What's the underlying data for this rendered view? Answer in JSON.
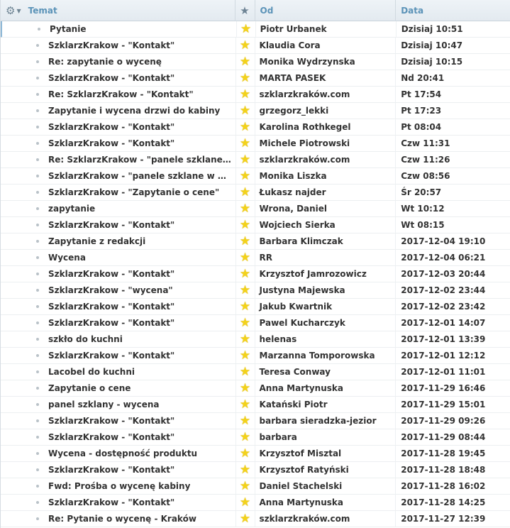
{
  "header": {
    "options_icon": "gear-icon",
    "subject_label": "Temat",
    "star_icon": "star-icon",
    "from_label": "Od",
    "date_label": "Data"
  },
  "colors": {
    "header_text": "#5b93b8",
    "star": "#f3d21b",
    "selected_indicator": "#8fb8d6"
  },
  "messages": [
    {
      "subject": "Pytanie",
      "from": "Piotr Urbanek",
      "date": "Dzisiaj 10:51"
    },
    {
      "subject": "SzklarzKrakow - \"Kontakt\"",
      "from": "Klaudia Cora",
      "date": "Dzisiaj 10:47"
    },
    {
      "subject": "Re: zapytanie o wycenę",
      "from": "Monika Wydrzynska",
      "date": "Dzisiaj 10:15"
    },
    {
      "subject": "SzklarzKrakow - \"Kontakt\"",
      "from": "MARTA PASEK",
      "date": "Nd 20:41"
    },
    {
      "subject": "Re: SzklarzKrakow - \"Kontakt\"",
      "from": "szklarzkraków.com",
      "date": "Pt 17:54"
    },
    {
      "subject": "Zapytanie i wycena drzwi do kabiny",
      "from": "grzegorz_lekki",
      "date": "Pt 17:23"
    },
    {
      "subject": "SzklarzKrakow - \"Kontakt\"",
      "from": "Karolina Rothkegel",
      "date": "Pt 08:04"
    },
    {
      "subject": "SzklarzKrakow - \"Kontakt\"",
      "from": "Michele Piotrowski",
      "date": "Czw 11:31"
    },
    {
      "subject": "Re: SzklarzKrakow - \"panele szklane ...",
      "from": "szklarzkraków.com",
      "date": "Czw 11:26"
    },
    {
      "subject": "SzklarzKrakow - \"panele szklane w k...",
      "from": "Monika Liszka",
      "date": "Czw 08:56"
    },
    {
      "subject": "SzklarzKrakow - \"Zapytanie o cene\"",
      "from": "Łukasz najder",
      "date": "Śr 20:57"
    },
    {
      "subject": "zapytanie",
      "from": "Wrona, Daniel",
      "date": "Wt 10:12"
    },
    {
      "subject": "SzklarzKrakow - \"Kontakt\"",
      "from": "Wojciech Sierka",
      "date": "Wt 08:15"
    },
    {
      "subject": "Zapytanie z redakcji",
      "from": "Barbara Klimczak",
      "date": "2017-12-04 19:10"
    },
    {
      "subject": "Wycena",
      "from": "RR",
      "date": "2017-12-04 06:21"
    },
    {
      "subject": "SzklarzKrakow - \"Kontakt\"",
      "from": "Krzysztof Jamrozowicz",
      "date": "2017-12-03 20:44"
    },
    {
      "subject": "SzklarzKrakow - \"wycena\"",
      "from": "Justyna Majewska",
      "date": "2017-12-02 23:44"
    },
    {
      "subject": "SzklarzKrakow - \"Kontakt\"",
      "from": "Jakub Kwartnik",
      "date": "2017-12-02 23:42"
    },
    {
      "subject": "SzklarzKrakow - \"Kontakt\"",
      "from": "Pawel Kucharczyk",
      "date": "2017-12-01 14:07"
    },
    {
      "subject": "szkło do kuchni",
      "from": "helenas",
      "date": "2017-12-01 13:39"
    },
    {
      "subject": "SzklarzKrakow - \"Kontakt\"",
      "from": "Marzanna Tomporowska",
      "date": "2017-12-01 12:12"
    },
    {
      "subject": "Lacobel do kuchni",
      "from": "Teresa Conway",
      "date": "2017-12-01 11:01"
    },
    {
      "subject": "Zapytanie o cene",
      "from": "Anna Martynuska",
      "date": "2017-11-29 16:46"
    },
    {
      "subject": "panel szklany - wycena",
      "from": "Katański Piotr",
      "date": "2017-11-29 15:01"
    },
    {
      "subject": "SzklarzKrakow - \"Kontakt\"",
      "from": "barbara sieradzka-jezior",
      "date": "2017-11-29 09:26"
    },
    {
      "subject": "SzklarzKrakow - \"Kontakt\"",
      "from": "barbara",
      "date": "2017-11-29 08:44"
    },
    {
      "subject": "Wycena - dostępność produktu",
      "from": "Krzysztof Misztal",
      "date": "2017-11-28 19:45"
    },
    {
      "subject": "SzklarzKrakow - \"Kontakt\"",
      "from": "Krzysztof Ratyński",
      "date": "2017-11-28 18:48"
    },
    {
      "subject": "Fwd: Prośba o wycenę kabiny",
      "from": "Daniel Stachelski",
      "date": "2017-11-28 16:02"
    },
    {
      "subject": "SzklarzKrakow - \"Kontakt\"",
      "from": "Anna Martynuska",
      "date": "2017-11-28 14:25"
    },
    {
      "subject": "Re: Pytanie o wycenę - Kraków",
      "from": "szklarzkraków.com",
      "date": "2017-11-27 12:39"
    }
  ]
}
